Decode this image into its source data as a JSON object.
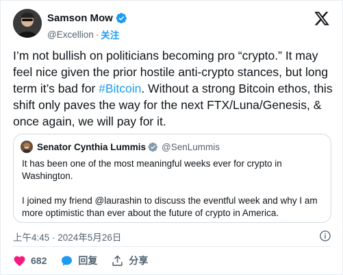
{
  "author": {
    "name": "Samson Mow",
    "handle": "@Excellion",
    "separator": "·",
    "follow_label": "关注"
  },
  "tweet": {
    "text_part1": "I’m not bullish on politicians becoming pro “crypto.” It may feel nice given the prior hostile anti-crypto stances, but long term it’s bad for ",
    "hashtag": "#Bitcoin",
    "text_part2": ". Without a strong Bitcoin ethos, this shift only paves the way for the next FTX/Luna/Genesis, & once again, we will pay for it."
  },
  "quote": {
    "name": "Senator Cynthia Lummis",
    "handle": "@SenLummis",
    "paragraph1": "It has been one of the most meaningful weeks ever for crypto in Washington.",
    "paragraph2": "I joined my friend @laurashin to discuss the eventful week and why I am more optimistic than ever about the future of crypto in America."
  },
  "meta": {
    "timestamp": "上午4:45 · 2024年5月26日"
  },
  "actions": {
    "like_count": "682",
    "reply_label": "回复",
    "share_label": "分享"
  },
  "colors": {
    "accent": "#1d9bf0",
    "like_red": "#f91880",
    "text": "#0f1419",
    "muted": "#536471"
  }
}
